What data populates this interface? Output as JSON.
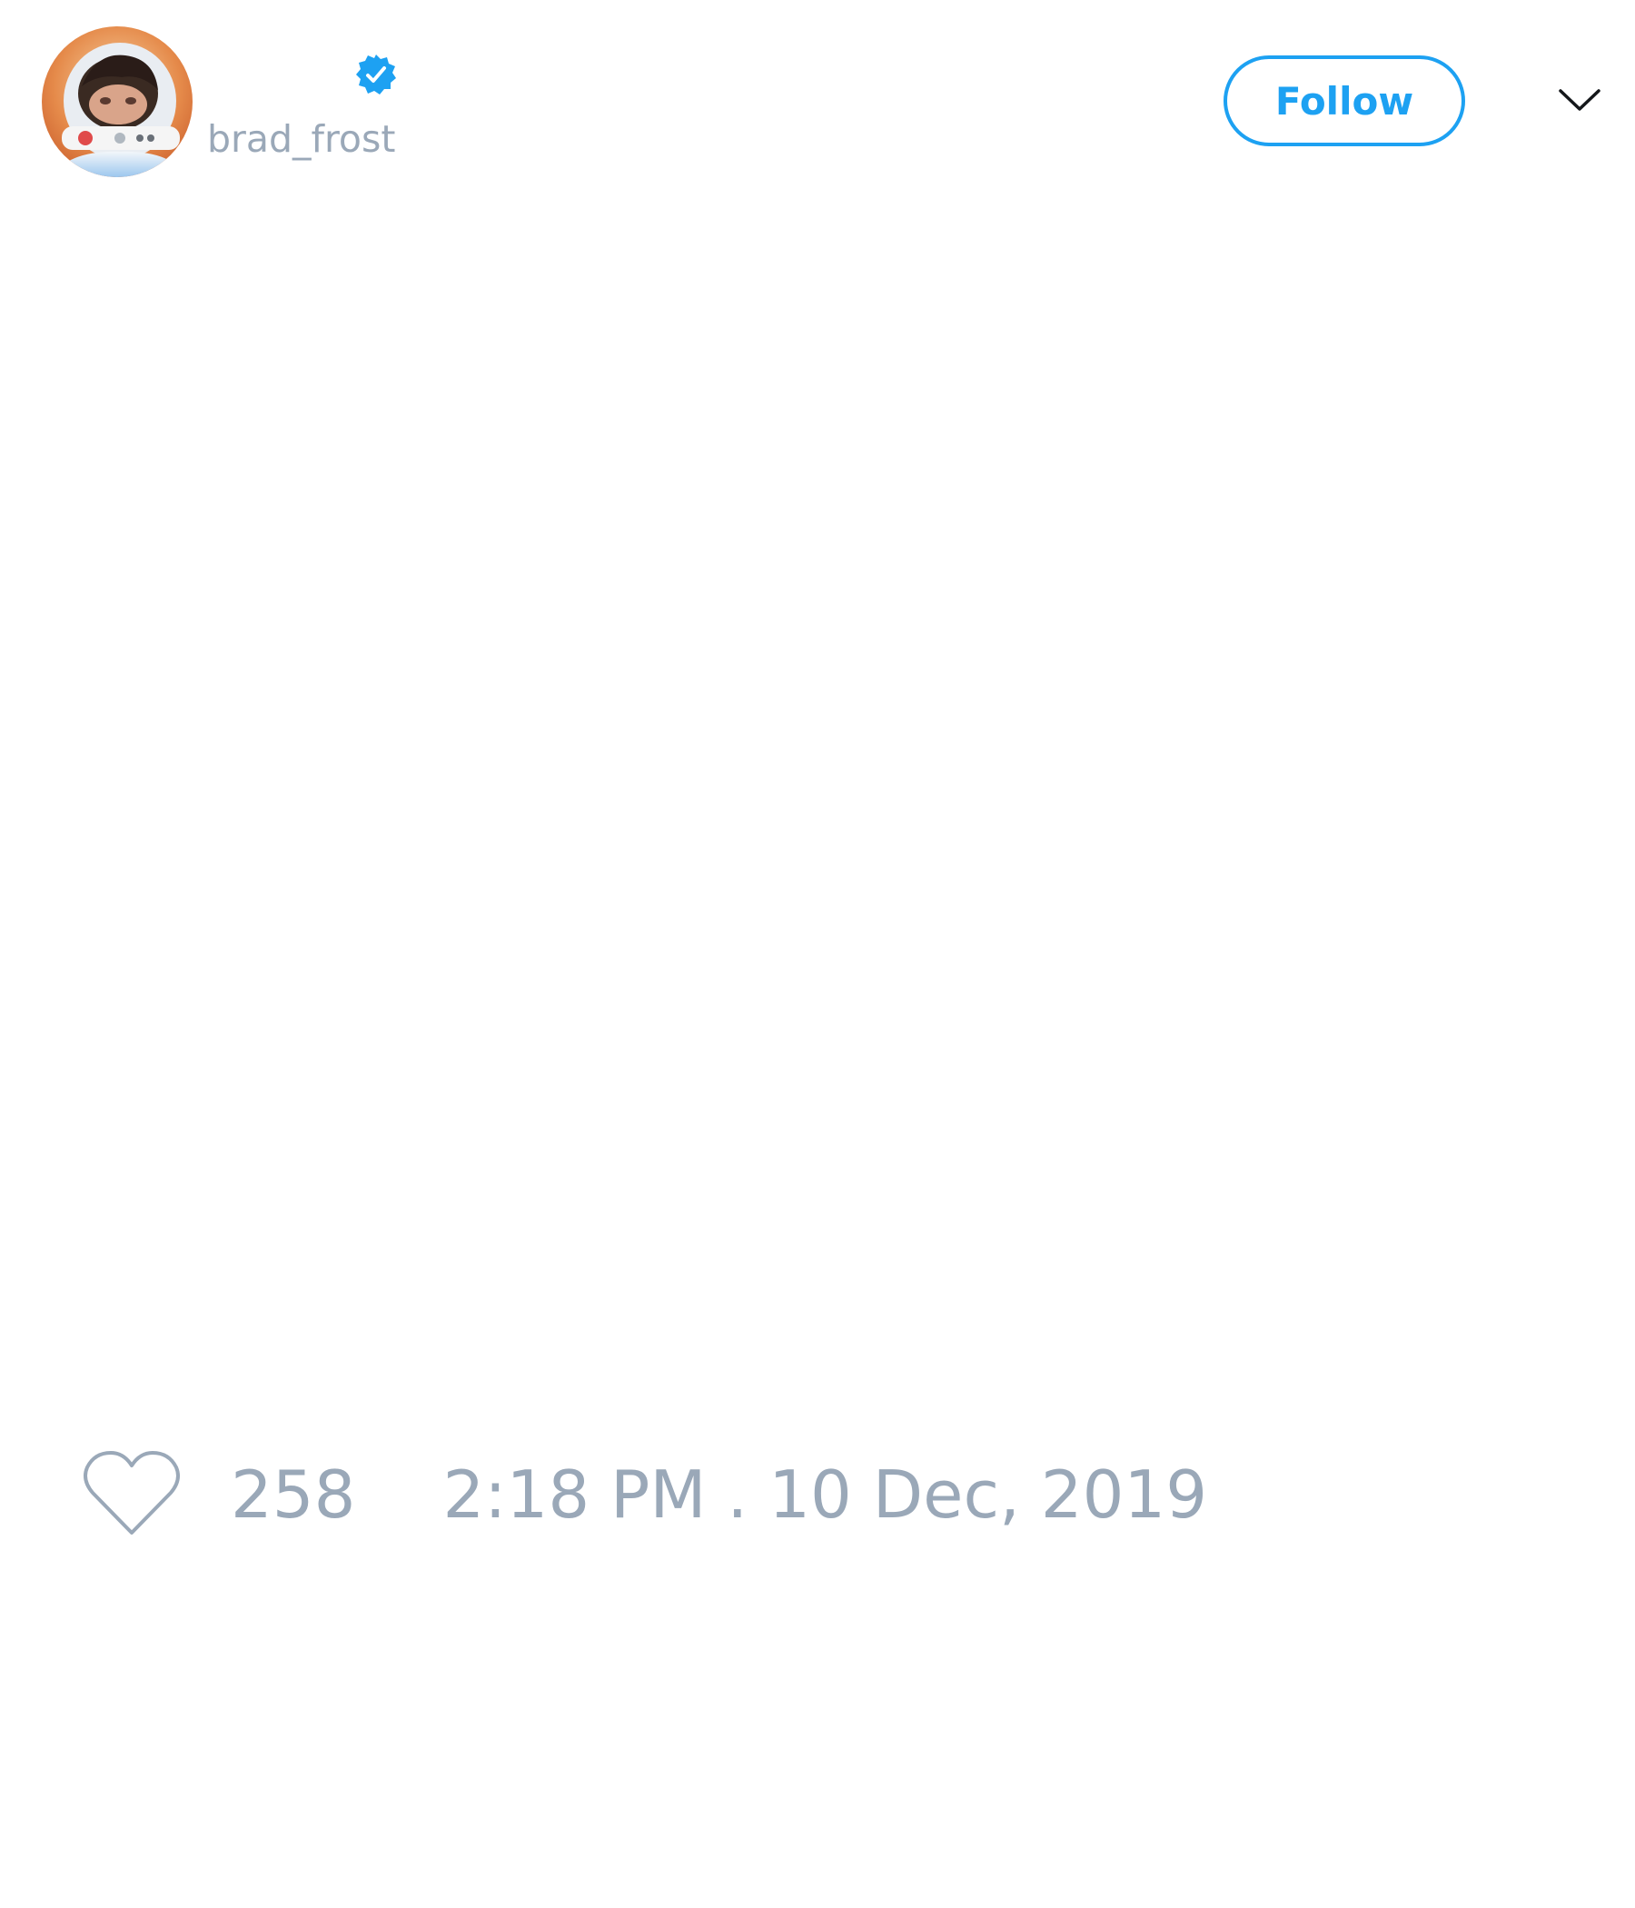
{
  "author": {
    "display_name": "",
    "handle": "brad_frost",
    "verified": true,
    "avatar": "astronaut-helmet-avatar"
  },
  "header": {
    "follow_label": "Follow",
    "menu_icon": "chevron-down-icon"
  },
  "tweet": {
    "text": ""
  },
  "footer": {
    "like_icon": "heart-icon",
    "like_count": "258",
    "timestamp": "2:18 PM . 10 Dec, 2019"
  },
  "colors": {
    "accent": "#1da1f2",
    "muted_text": "#9aa8b8",
    "background": "#ffffff"
  }
}
